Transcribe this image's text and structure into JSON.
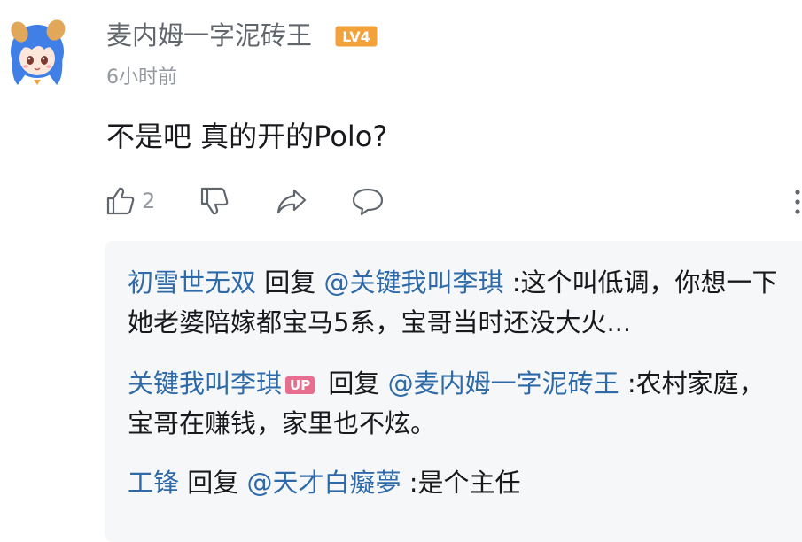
{
  "comment": {
    "username": "麦内姆一字泥砖王",
    "level_badge": "LV4",
    "time": "6小时前",
    "text": "不是吧 真的开的Polo?",
    "like_count": "2"
  },
  "replies": [
    {
      "user": "初雪世无双",
      "verb": "回复",
      "mention": "@关键我叫李琪",
      "text": ":这个叫低调，你想一下她老婆陪嫁都宝马5系，宝哥当时还没大火..."
    },
    {
      "user": "关键我叫李琪",
      "badge": "UP",
      "verb": "回复",
      "mention": "@麦内姆一字泥砖王",
      "text": ":农村家庭，宝哥在赚钱，家里也不炫。"
    },
    {
      "user": "工锋",
      "verb": "回复",
      "mention": "@天才白癡夢",
      "text": ":是个主任"
    }
  ],
  "colors": {
    "link_blue": "#2e6aa8",
    "level_orange": "#f3a13a",
    "up_pink": "#e86e8f",
    "reply_bg": "#f6f7f8"
  },
  "icons": [
    "avatar",
    "level-badge",
    "like-icon",
    "dislike-icon",
    "share-icon",
    "comment-icon",
    "more-icon"
  ]
}
